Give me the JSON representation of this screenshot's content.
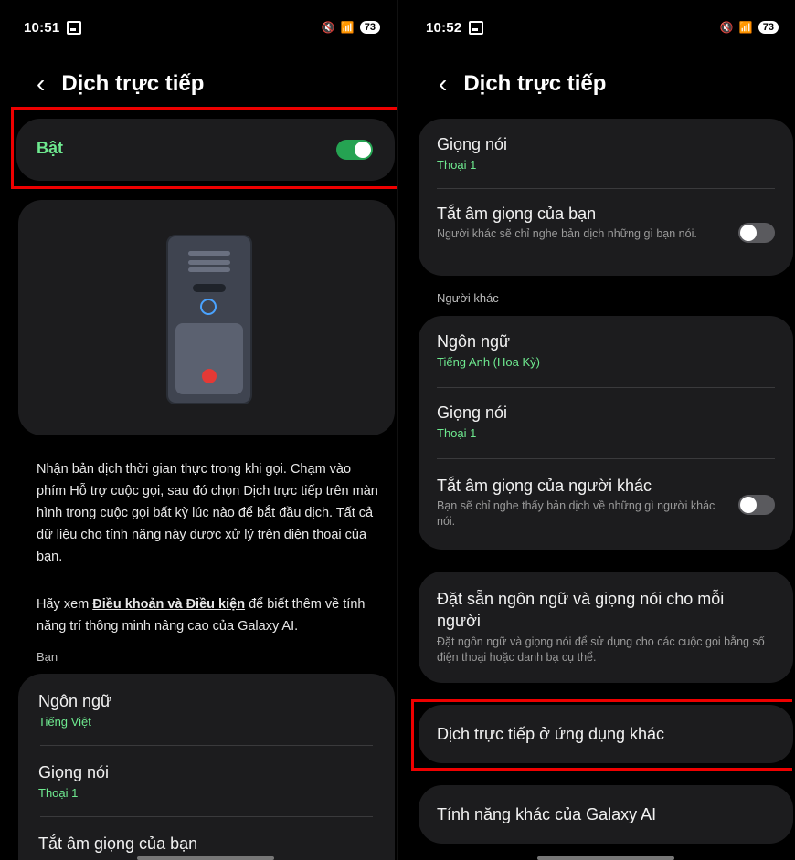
{
  "left": {
    "status": {
      "time": "10:51",
      "battery": "73"
    },
    "header": {
      "title": "Dịch trực tiếp"
    },
    "master_toggle": {
      "label": "Bật",
      "on": true
    },
    "description": {
      "para1": "Nhận bản dịch thời gian thực trong khi gọi. Chạm vào phím Hỗ trợ cuộc gọi, sau đó chọn Dịch trực tiếp trên màn hình trong cuộc gọi bất kỳ lúc nào để bắt đầu dịch. Tất cả dữ liệu cho tính năng này được xử lý trên điện thoại của bạn.",
      "para2_prefix": "Hãy xem ",
      "para2_link": "Điều khoản và Điều kiện",
      "para2_suffix": " để biết thêm về tính năng trí thông minh nâng cao của Galaxy AI."
    },
    "section_you": "Bạn",
    "you_items": [
      {
        "title": "Ngôn ngữ",
        "value": "Tiếng Việt"
      },
      {
        "title": "Giọng nói",
        "value": "Thoại 1"
      },
      {
        "title": "Tắt âm giọng của bạn"
      }
    ]
  },
  "right": {
    "status": {
      "time": "10:52",
      "battery": "73"
    },
    "header": {
      "title": "Dịch trực tiếp"
    },
    "you_voice": {
      "title": "Giọng nói",
      "value": "Thoại 1"
    },
    "mute_you": {
      "title": "Tắt âm giọng của bạn",
      "desc": "Người khác sẽ chỉ nghe bản dịch những gì bạn nói.",
      "on": false
    },
    "section_other": "Người khác",
    "other_language": {
      "title": "Ngôn ngữ",
      "value": "Tiếng Anh (Hoa Kỳ)"
    },
    "other_voice": {
      "title": "Giọng nói",
      "value": "Thoại 1"
    },
    "mute_other": {
      "title": "Tắt âm giọng của người khác",
      "desc": "Bạn sẽ chỉ nghe thấy bản dịch về những gì người khác nói.",
      "on": false
    },
    "preset": {
      "title": "Đặt sẵn ngôn ngữ và giọng nói cho mỗi người",
      "desc": "Đặt ngôn ngữ và giọng nói để sử dụng cho các cuộc gọi bằng số điện thoại hoặc danh bạ cụ thể."
    },
    "other_apps": {
      "title": "Dịch trực tiếp ở ứng dụng khác"
    },
    "more_ai": {
      "title": "Tính năng khác của Galaxy AI"
    }
  },
  "colors": {
    "accent_green": "#25a352",
    "value_green": "#6ee98f",
    "highlight_red": "#e00000",
    "card_bg": "#1c1c1e"
  }
}
